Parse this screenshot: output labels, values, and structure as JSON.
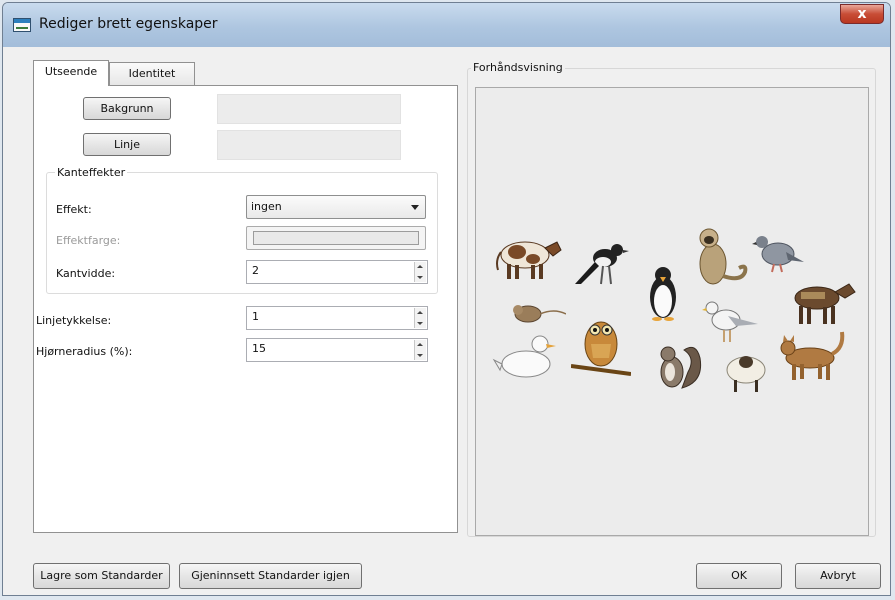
{
  "window": {
    "title": "Rediger brett egenskaper",
    "close_glyph": "x"
  },
  "tabs": [
    {
      "label": "Utseende",
      "active": true
    },
    {
      "label": "Identitet",
      "active": false
    }
  ],
  "appearance": {
    "background_button": "Bakgrunn",
    "line_button": "Linje",
    "edge_effects": {
      "legend": "Kanteffekter",
      "effect_label": "Effekt:",
      "effect_value": "ingen",
      "effect_color_label": "Effektfarge:",
      "edge_width_label": "Kantvidde:",
      "edge_width_value": "2"
    },
    "line_thickness_label": "Linjetykkelse:",
    "line_thickness_value": "1",
    "corner_radius_label": "Hjørneradius (%):",
    "corner_radius_value": "15"
  },
  "preview": {
    "title": "Forhåndsvisning",
    "animals": [
      "cow",
      "magpie",
      "penguin",
      "monkey",
      "pigeon",
      "rat",
      "seagull",
      "donkey",
      "duck",
      "owl",
      "squirrel",
      "sheep",
      "cat"
    ]
  },
  "footer": {
    "save_defaults": "Lagre som Standarder",
    "restore_defaults": "Gjeninnsett Standarder igjen",
    "ok": "OK",
    "cancel": "Avbryt"
  }
}
